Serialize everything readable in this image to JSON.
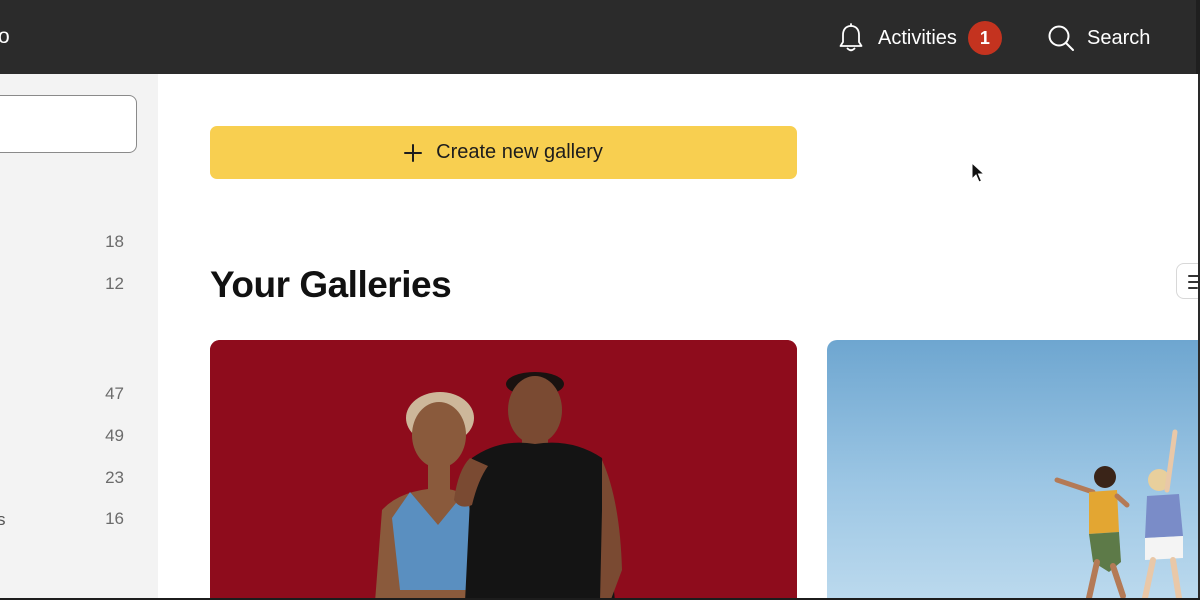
{
  "topbar": {
    "brand_fragment": "o",
    "activities_label": "Activities",
    "activities_count": "1",
    "search_label": "Search",
    "icons": [
      "bell-icon",
      "search-icon"
    ]
  },
  "sidebar": {
    "counts": [
      "18",
      "12",
      "47",
      "49",
      "23",
      "16"
    ],
    "fragment": "s",
    "search_value": ""
  },
  "main": {
    "create_label": "Create new gallery",
    "title": "Your Galleries",
    "galleries": [
      {
        "image": "photo of two people against red backdrop"
      },
      {
        "image": "photo of two women jumping on beach under blue sky"
      }
    ]
  },
  "colors": {
    "topbar": "#2b2b2b",
    "accent_yellow": "#f8cf50",
    "badge_red": "#c4331f",
    "sidebar_bg": "#f3f3f3"
  }
}
